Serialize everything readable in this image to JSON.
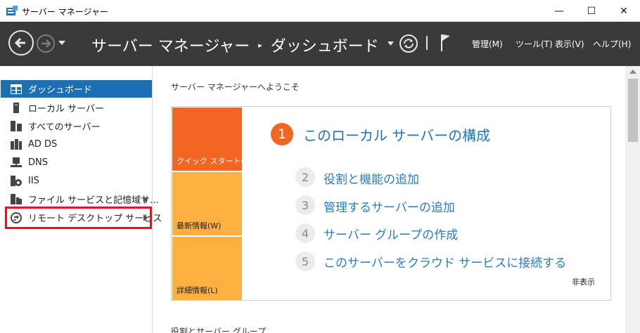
{
  "window": {
    "title": "サーバー マネージャー",
    "minimize_glyph": "—",
    "maximize_glyph": "☐",
    "close_glyph": "✕"
  },
  "header": {
    "breadcrumb_root": "サーバー マネージャー",
    "breadcrumb_separator": "▸",
    "breadcrumb_current": "ダッシュボード",
    "menus": [
      "管理(M)",
      "ツール(T)",
      "表示(V)",
      "ヘルプ(H)"
    ]
  },
  "sidebar": {
    "items": [
      {
        "label": "ダッシュボード",
        "icon": "dashboard-icon",
        "active": true
      },
      {
        "label": "ローカル サーバー",
        "icon": "local-server-icon"
      },
      {
        "label": "すべてのサーバー",
        "icon": "all-servers-icon"
      },
      {
        "label": "AD DS",
        "icon": "ad-ds-icon"
      },
      {
        "label": "DNS",
        "icon": "dns-icon"
      },
      {
        "label": "IIS",
        "icon": "iis-icon"
      },
      {
        "label": "ファイル サービスと記憶域サ...",
        "icon": "file-services-icon",
        "expandable": true
      },
      {
        "label": "リモート デスクトップ サービス",
        "icon": "remote-desktop-icon",
        "expandable": true,
        "highlighted": true
      }
    ]
  },
  "main": {
    "welcome_title": "サーバー マネージャーへようこそ",
    "tiles": [
      "クイック スタート(Q)",
      "最新情報(W)",
      "詳細情報(L)"
    ],
    "steps": [
      {
        "num": "1",
        "label": "このローカル サーバーの構成"
      },
      {
        "num": "2",
        "label": "役割と機能の追加"
      },
      {
        "num": "3",
        "label": "管理するサーバーの追加"
      },
      {
        "num": "4",
        "label": "サーバー グループの作成"
      },
      {
        "num": "5",
        "label": "このサーバーをクラウド サービスに接続する"
      }
    ],
    "hide_label": "非表示",
    "next_section": "役割とサーバー グループ"
  },
  "colors": {
    "header_bg": "#3a3a3a",
    "active_item": "#1a6fb5",
    "quick_start_tile": "#f26522",
    "info_tiles": "#fbb040",
    "link_blue": "#2b7bc4",
    "highlight_red": "#e8131b"
  }
}
